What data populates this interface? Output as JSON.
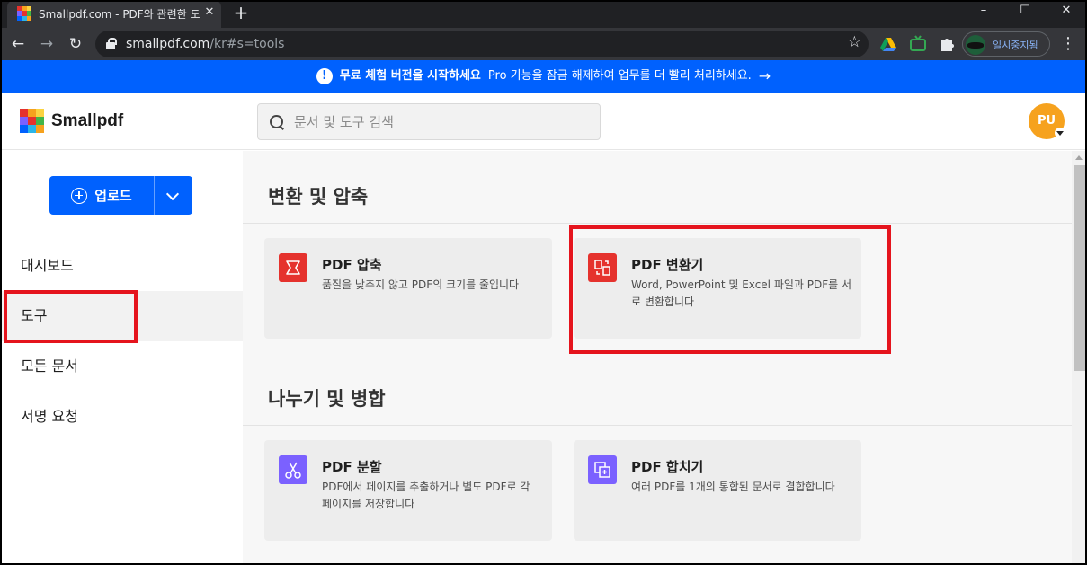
{
  "browser": {
    "tab_title": "Smallpdf.com - PDF와 관련한 도",
    "tab_close": "✕",
    "new_tab": "+",
    "window_controls": [
      "–",
      "☐",
      "✕"
    ],
    "nav_back": "←",
    "nav_forward": "→",
    "reload": "↻",
    "url_host": "smallpdf.com",
    "url_path": "/kr#s=tools",
    "bookmark_star": "☆",
    "extensions": [
      "drive-icon",
      "tv-icon",
      "puzzle-icon"
    ],
    "profile_label": "일시중지됨",
    "menu": "⋮"
  },
  "banner": {
    "icon": "!",
    "strong": "무료 체험 버전을 시작하세요",
    "text": "Pro 기능을 잠금 해제하여 업무를 더 빨리 처리하세요.",
    "arrow": "→",
    "color": "#0061fe"
  },
  "header": {
    "logo_text": "Smallpdf",
    "search_placeholder": "문서 및 도구 검색",
    "avatar_initials": "PU",
    "avatar_color": "#f6a21e"
  },
  "sidebar": {
    "upload_label": "업로드",
    "items": [
      {
        "label": "대시보드",
        "active": false
      },
      {
        "label": "도구",
        "active": true
      },
      {
        "label": "모든 문서",
        "active": false
      },
      {
        "label": "서명 요청",
        "active": false
      }
    ]
  },
  "main": {
    "sections": [
      {
        "title": "변환 및 압축",
        "cards": [
          {
            "title": "PDF 압축",
            "desc": "품질을 낮추지 않고 PDF의 크기를 줄입니다",
            "icon": "compress-icon",
            "color": "#e5322d"
          },
          {
            "title": "PDF 변환기",
            "desc": "Word, PowerPoint 및 Excel 파일과 PDF를 서로 변환합니다",
            "icon": "convert-icon",
            "color": "#e5322d"
          }
        ]
      },
      {
        "title": "나누기 및 병합",
        "cards": [
          {
            "title": "PDF 분할",
            "desc": "PDF에서 페이지를 추출하거나 별도 PDF로 각 페이지를 저장합니다",
            "icon": "scissors-icon",
            "color": "#7b61ff"
          },
          {
            "title": "PDF 합치기",
            "desc": "여러 PDF를 1개의 통합된 문서로 결합합니다",
            "icon": "merge-icon",
            "color": "#7b61ff"
          }
        ]
      }
    ]
  }
}
